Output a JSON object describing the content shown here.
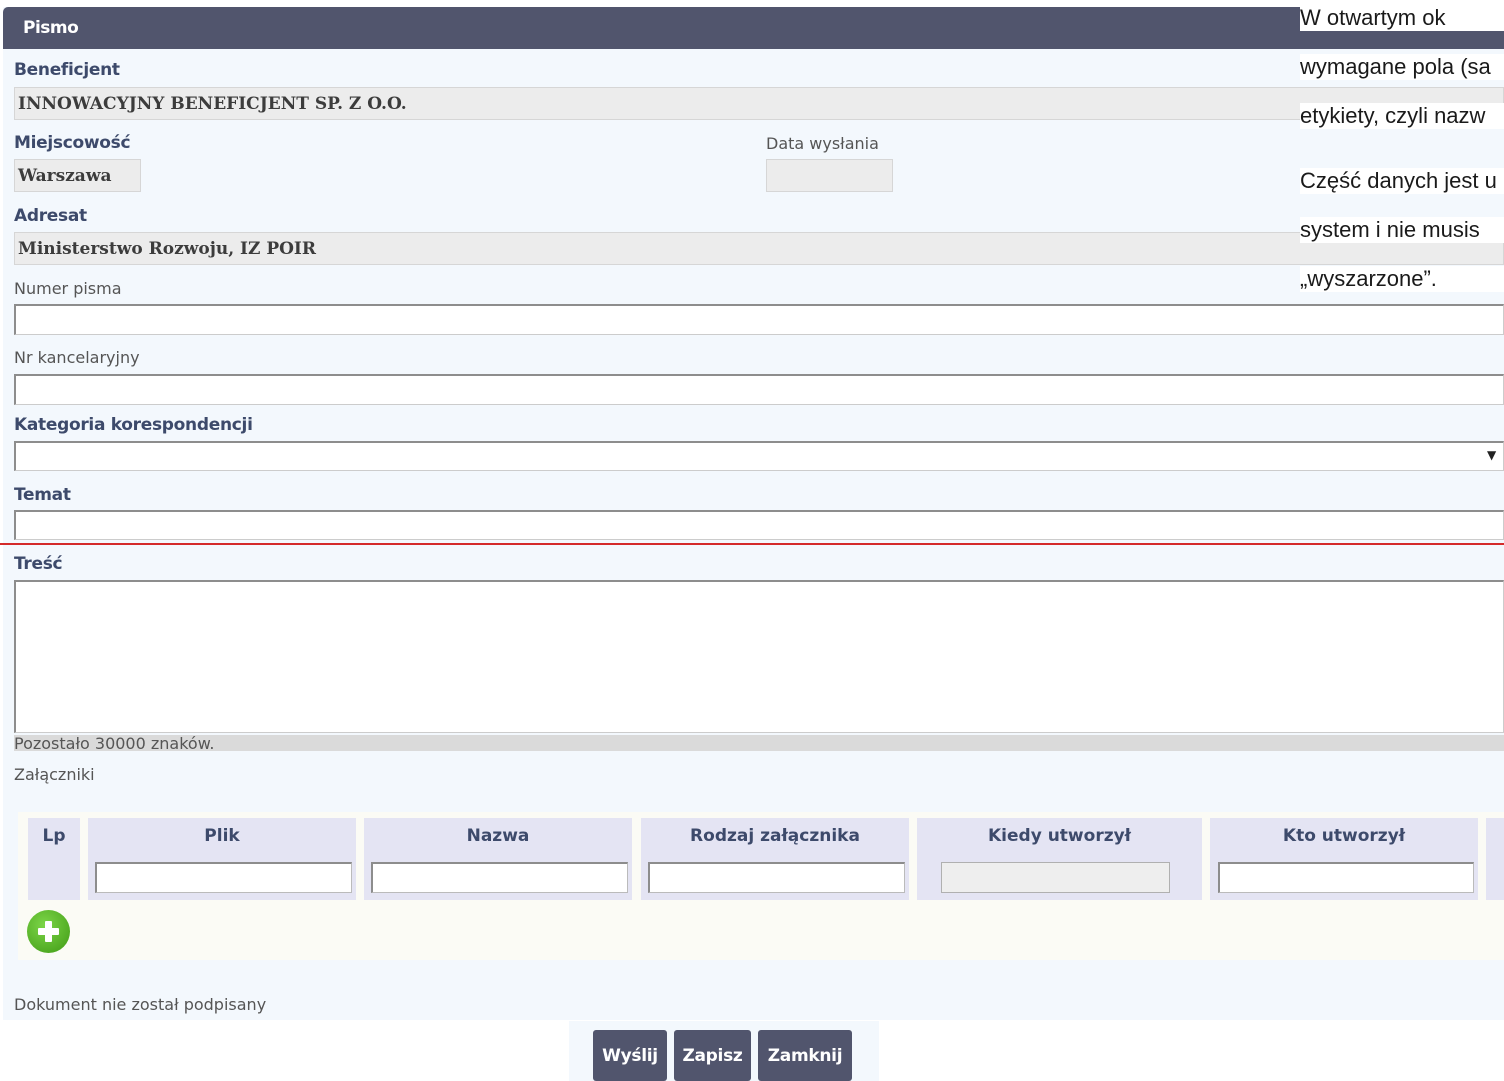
{
  "form": {
    "title": "Pismo",
    "beneficjent_label": "Beneficjent",
    "beneficjent_value": "INNOWACYJNY BENEFICJENT SP. Z O.O.",
    "miejscowosc_label": "Miejscowość",
    "miejscowosc_value": "Warszawa",
    "data_wyslania_label": "Data wysłania",
    "data_wyslania_value": "",
    "adresat_label": "Adresat",
    "adresat_value": "Ministerstwo Rozwoju, IZ POIR",
    "numer_pisma_label": "Numer pisma",
    "nr_kancelaryjny_label": "Nr kancelaryjny",
    "kategoria_label": "Kategoria korespondencji",
    "kategoria_value": "",
    "temat_label": "Temat",
    "tresc_label": "Treść",
    "tresc_counter": "Pozostało 30000 znaków.",
    "zalaczniki_label": "Załączniki",
    "status_text": "Dokument nie został podpisany"
  },
  "attachments": {
    "columns": [
      "Lp",
      "Plik",
      "Nazwa",
      "Rodzaj załącznika",
      "Kiedy utworzył",
      "Kto utworzył"
    ],
    "add_icon": "plus-circle-icon"
  },
  "buttons": {
    "send": "Wyślij",
    "save": "Zapisz",
    "close": "Zamknij"
  },
  "help_text": {
    "line1": "W   otwartym   ok",
    "line2": "wymagane pola (sa",
    "line3": "etykiety, czyli nazw",
    "line4": "Część danych jest u",
    "line5": "system  i  nie  musis",
    "line6": "„wyszarzone”."
  },
  "colors": {
    "header": "#51556d",
    "panel": "#f3f8fd",
    "label": "#3d4a6b",
    "add_green": "#4aa81c",
    "error_line": "#d42a2a"
  }
}
